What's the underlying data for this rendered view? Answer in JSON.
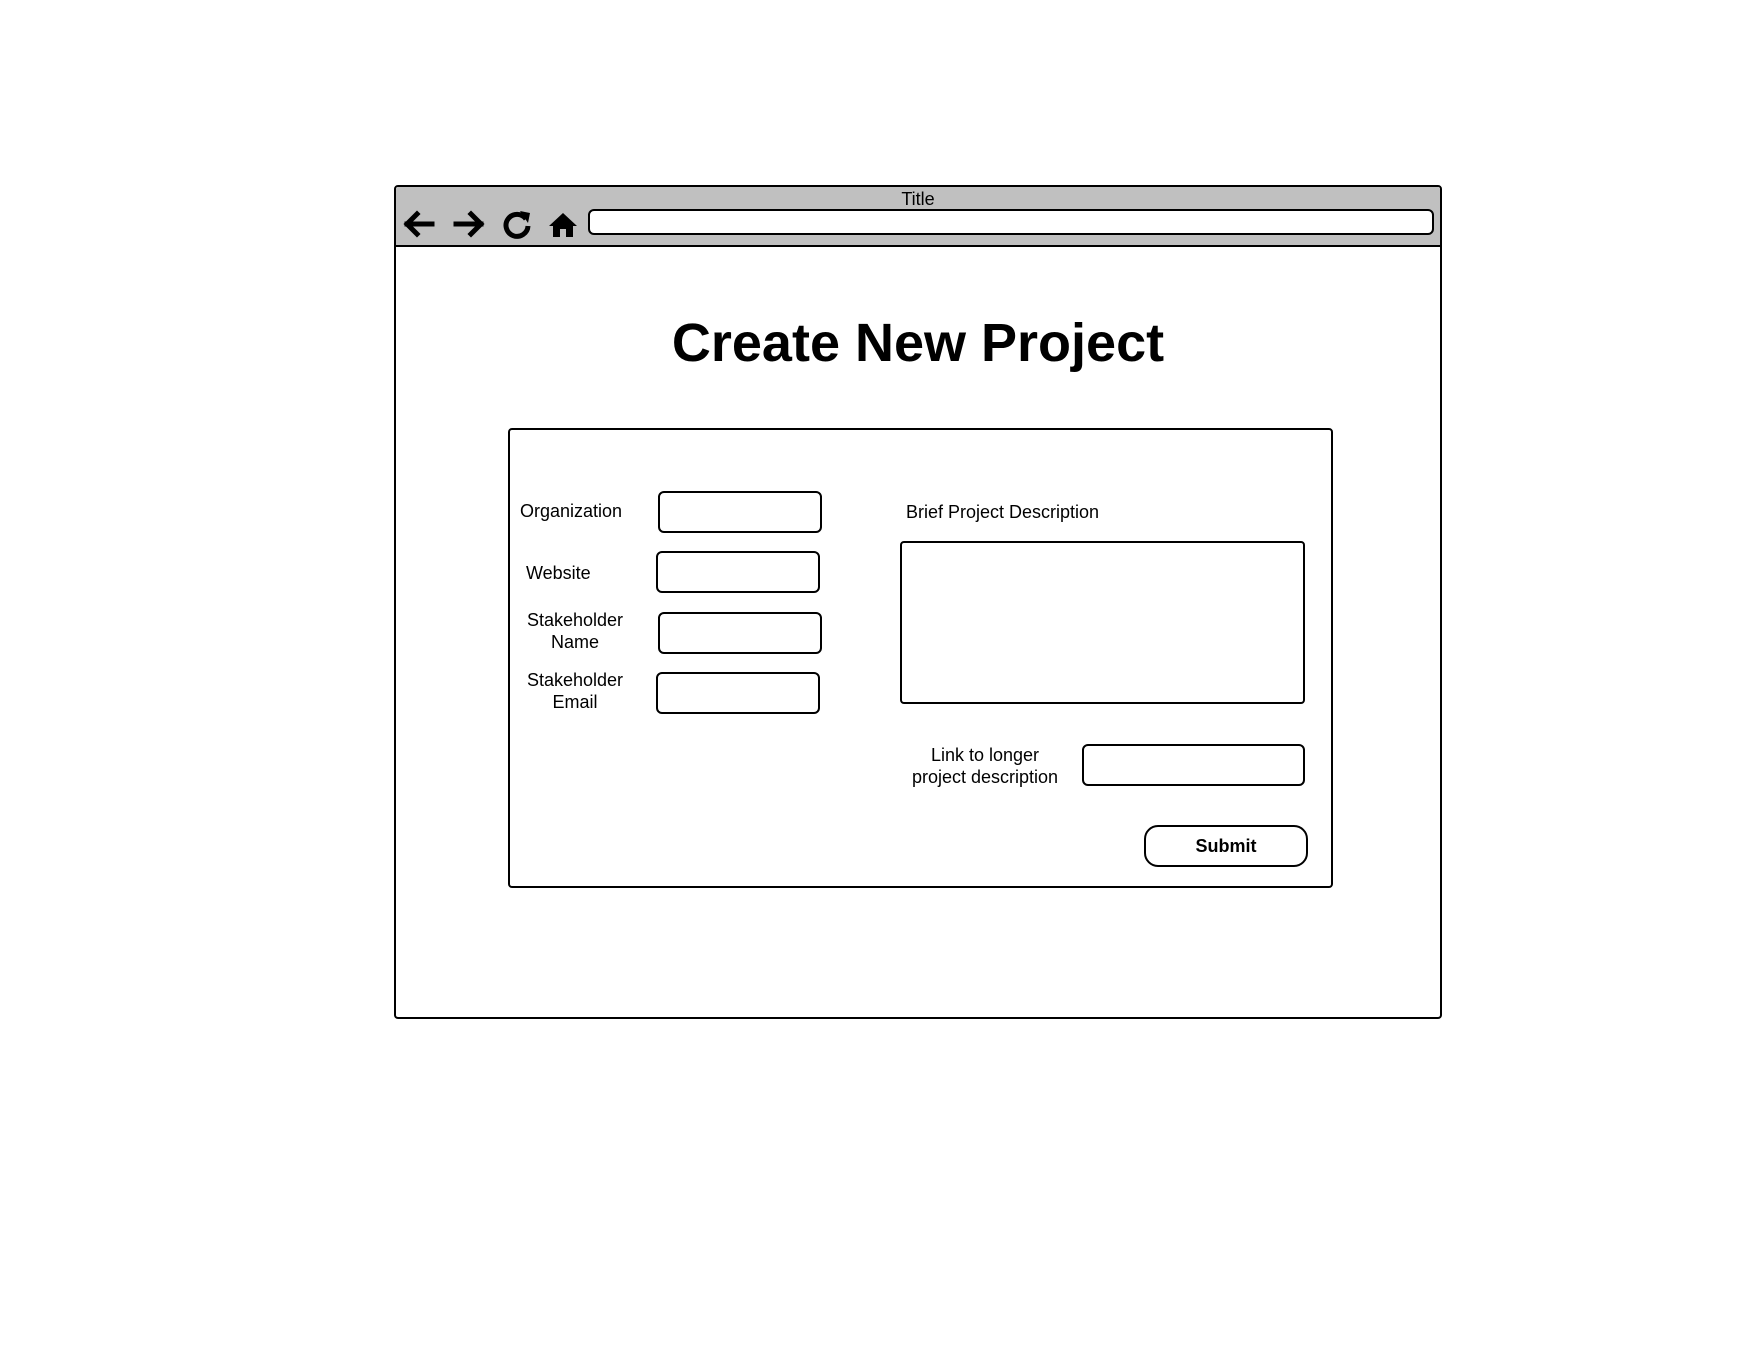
{
  "window": {
    "title": "Title",
    "address": ""
  },
  "toolbar": {
    "icons": [
      "back-arrow-icon",
      "forward-arrow-icon",
      "reload-icon",
      "home-icon"
    ]
  },
  "page": {
    "heading": "Create New Project"
  },
  "form": {
    "organization": {
      "label": "Organization",
      "value": ""
    },
    "website": {
      "label": "Website",
      "value": ""
    },
    "stakeholder_name": {
      "label": "Stakeholder Name",
      "value": ""
    },
    "stakeholder_email": {
      "label": "Stakeholder Email",
      "value": ""
    },
    "brief_description": {
      "label": "Brief Project Description",
      "value": ""
    },
    "long_description_link": {
      "label": "Link to longer project description",
      "value": ""
    },
    "submit_label": "Submit"
  }
}
